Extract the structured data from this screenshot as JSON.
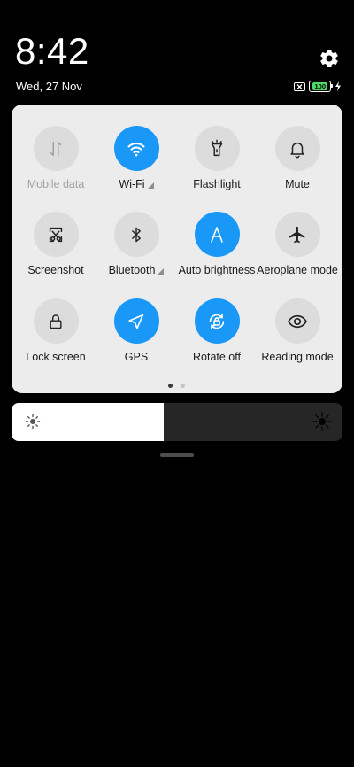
{
  "header": {
    "time": "8:42",
    "date": "Wed, 27 Nov",
    "battery_level": "100"
  },
  "tiles": [
    {
      "label": "Mobile data",
      "icon": "mobile-data-icon",
      "state": "disabled",
      "signal": false
    },
    {
      "label": "Wi-Fi",
      "icon": "wifi-icon",
      "state": "on",
      "signal": true
    },
    {
      "label": "Flashlight",
      "icon": "flashlight-icon",
      "state": "off",
      "signal": false
    },
    {
      "label": "Mute",
      "icon": "bell-icon",
      "state": "off",
      "signal": false
    },
    {
      "label": "Screenshot",
      "icon": "screenshot-scissors-icon",
      "state": "off",
      "signal": false
    },
    {
      "label": "Bluetooth",
      "icon": "bluetooth-icon",
      "state": "off",
      "signal": true
    },
    {
      "label": "Auto brightness",
      "icon": "auto-brightness-icon",
      "state": "on",
      "signal": false
    },
    {
      "label": "Aeroplane mode",
      "icon": "airplane-icon",
      "state": "off",
      "signal": false
    },
    {
      "label": "Lock screen",
      "icon": "lock-icon",
      "state": "off",
      "signal": false
    },
    {
      "label": "GPS",
      "icon": "location-arrow-icon",
      "state": "on",
      "signal": false
    },
    {
      "label": "Rotate off",
      "icon": "rotation-lock-icon",
      "state": "on",
      "signal": false
    },
    {
      "label": "Reading mode",
      "icon": "eye-icon",
      "state": "off",
      "signal": false
    }
  ],
  "pager": {
    "pages": 2,
    "current": 1
  },
  "brightness": {
    "level": 0.46
  },
  "colors": {
    "accent": "#1a98f7",
    "panel": "#ececec",
    "tile_off": "#dcdcdc"
  }
}
